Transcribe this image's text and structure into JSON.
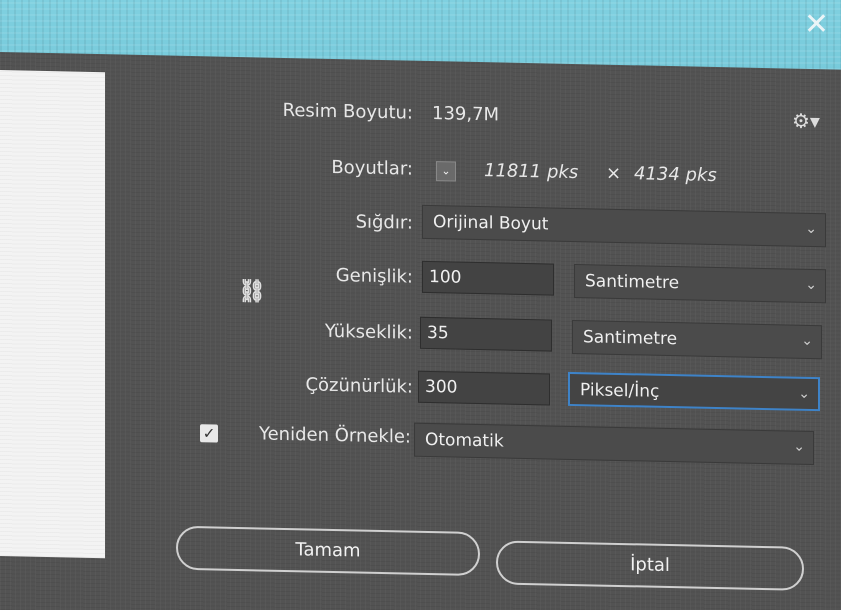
{
  "dialog": {
    "image_size_label": "Resim Boyutu:",
    "image_size_value": "139,7M",
    "dimensions_label": "Boyutlar:",
    "dimensions_width": "11811 pks",
    "dimensions_times": "×",
    "dimensions_height": "4134 pks",
    "fit_label": "Sığdır:",
    "fit_value": "Orijinal Boyut",
    "width_label": "Genişlik:",
    "width_value": "100",
    "width_unit": "Santimetre",
    "height_label": "Yükseklik:",
    "height_value": "35",
    "height_unit": "Santimetre",
    "resolution_label": "Çözünürlük:",
    "resolution_value": "300",
    "resolution_unit": "Piksel/İnç",
    "resample_checked": true,
    "resample_label": "Yeniden Örnekle:",
    "resample_value": "Otomatik",
    "ok_label": "Tamam",
    "cancel_label": "İptal"
  },
  "icons": {
    "close": "close-icon",
    "gear": "gear-icon",
    "link": "link-icon",
    "chevron": "chevron-down-icon",
    "check": "checkmark-icon"
  },
  "colors": {
    "dialog_bg": "#535353",
    "field_bg": "#434343",
    "focus_border": "#3e83c8",
    "text": "#e8e8e8"
  }
}
